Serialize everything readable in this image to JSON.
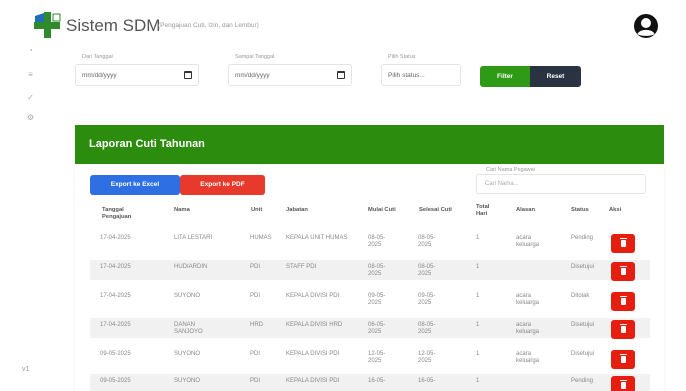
{
  "header": {
    "title": "Sistem SDM",
    "subtitle": "(Pengajuan Cuti, Izin, dan Lembur)"
  },
  "filters": {
    "start_date": {
      "label": "Dari Tanggal",
      "placeholder": "mm/dd/yyyy"
    },
    "end_date": {
      "label": "Sampai Tanggal",
      "placeholder": "mm/dd/yyyy"
    },
    "status": {
      "label": "Pilih Status",
      "value": "Pilih status..."
    },
    "filter_label": "Filter",
    "reset_label": "Reset"
  },
  "report": {
    "title": "Laporan Cuti Tahunan",
    "export_excel_label": "Export ke Excel",
    "export_pdf_label": "Export ke PDF",
    "search_label": "Cari Nama Pegawai",
    "search_placeholder": "Cari Nama..."
  },
  "table": {
    "columns": [
      "Tanggal Pengajuan",
      "Nama",
      "Unit",
      "Jabatan",
      "Mulai Cuti",
      "Selesai Cuti",
      "Total Hari",
      "Alasan",
      "Status",
      "Aksi"
    ],
    "rows": [
      {
        "tanggal": "17-04-2025",
        "nama": "LITA LESTARI",
        "unit": "HUMAS",
        "jabatan": "KEPALA UNIT HUMAS",
        "mulai": "08-05-2025",
        "selesai": "08-05-2025",
        "total": "1",
        "alasan": "acara keluarga",
        "status": "Pending"
      },
      {
        "tanggal": "17-04-2025",
        "nama": "HUDIARDIN",
        "unit": "PDI",
        "jabatan": "STAFF PDI",
        "mulai": "08-05-2025",
        "selesai": "08-05-2025",
        "total": "1",
        "alasan": "",
        "status": "Disetujui"
      },
      {
        "tanggal": "17-04-2025",
        "nama": "SUYONO",
        "unit": "PDI",
        "jabatan": "KEPALA DIVISI PDI",
        "mulai": "09-05-2025",
        "selesai": "09-05-2025",
        "total": "1",
        "alasan": "acara keluarga",
        "status": "Ditolak"
      },
      {
        "tanggal": "17-04-2025",
        "nama": "DANAN SANJOYO",
        "unit": "HRD",
        "jabatan": "KEPALA DIVISI HRD",
        "mulai": "06-05-2025",
        "selesai": "08-05-2025",
        "total": "1",
        "alasan": "acara keluarga",
        "status": "Disetujui"
      },
      {
        "tanggal": "09-05-2025",
        "nama": "SUYONO",
        "unit": "PDI",
        "jabatan": "KEPALA DIVISI PDI",
        "mulai": "12-05-2025",
        "selesai": "12-05-2025",
        "total": "1",
        "alasan": "acara keluarga",
        "status": "Disetujui"
      },
      {
        "tanggal": "09-05-2025",
        "nama": "SUYONO",
        "unit": "PDI",
        "jabatan": "KEPALA DIVISI PDI",
        "mulai": "16-05-",
        "selesai": "16-05-",
        "total": "1",
        "alasan": "",
        "status": "Pending"
      }
    ]
  },
  "sidebar": {
    "footer_text": "v1"
  }
}
